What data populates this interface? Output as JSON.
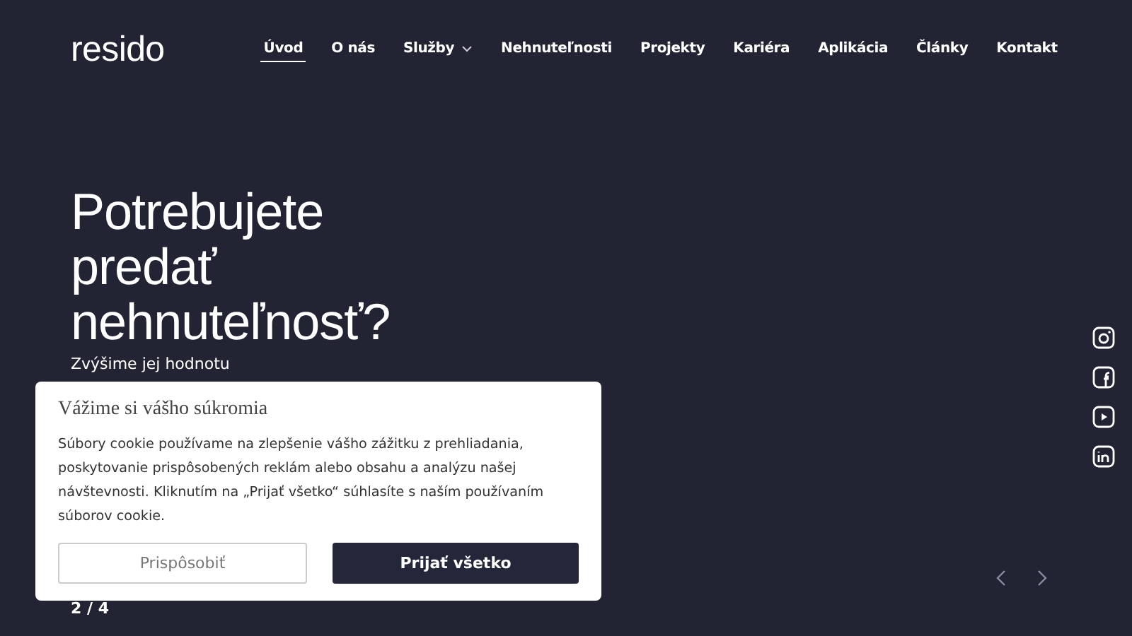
{
  "logo": "resido",
  "nav": [
    {
      "label": "Úvod",
      "selected": true,
      "dropdown": false
    },
    {
      "label": "O nás",
      "selected": false,
      "dropdown": false
    },
    {
      "label": "Služby",
      "selected": false,
      "dropdown": true
    },
    {
      "label": "Nehnuteľnosti",
      "selected": false,
      "dropdown": false
    },
    {
      "label": "Projekty",
      "selected": false,
      "dropdown": false
    },
    {
      "label": "Kariéra",
      "selected": false,
      "dropdown": false
    },
    {
      "label": "Aplikácia",
      "selected": false,
      "dropdown": false
    },
    {
      "label": "Články",
      "selected": false,
      "dropdown": false
    },
    {
      "label": "Kontakt",
      "selected": false,
      "dropdown": false
    }
  ],
  "hero": {
    "title_lines": [
      "Potrebujete",
      "predať",
      "nehnuteľnosť?"
    ],
    "subtitle": "Zvýšime jej hodnotu",
    "counter": "2 / 4"
  },
  "social": [
    {
      "kind": "instagram"
    },
    {
      "kind": "facebook"
    },
    {
      "kind": "youtube"
    },
    {
      "kind": "linkedin"
    }
  ],
  "cookie": {
    "title": "Vážime si vášho súkromia",
    "text": "Súbory cookie používame na zlepšenie vášho zážitku z prehliadania, poskytovanie prispôsobených reklám alebo obsahu a analýzu našej návštevnosti. Kliknutím na „Prijať všetko“ súhlasíte s naším používaním súborov cookie.",
    "buttons": [
      {
        "label": "Prispôsobiť",
        "kind": "outline"
      },
      {
        "label": "Prijať všetko",
        "kind": "primary"
      }
    ]
  }
}
